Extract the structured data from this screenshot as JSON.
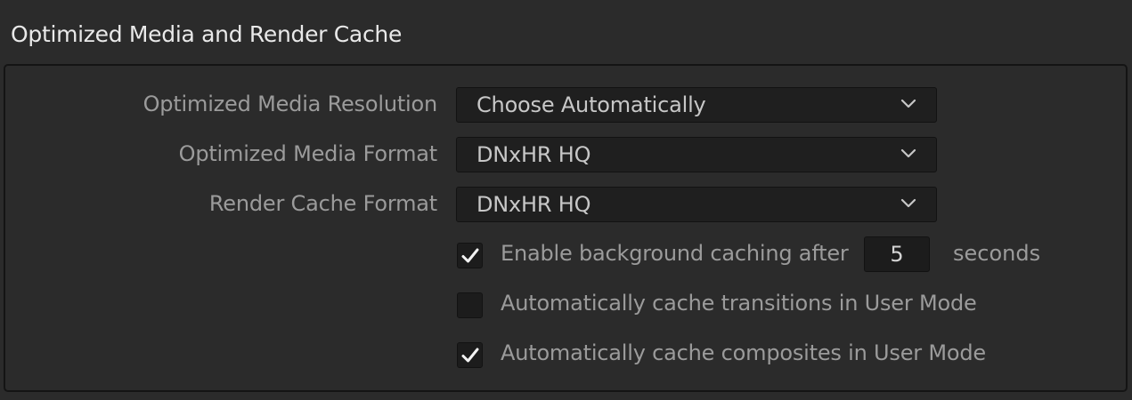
{
  "section": {
    "title": "Optimized Media and Render Cache"
  },
  "rows": {
    "resolution": {
      "label": "Optimized Media Resolution",
      "value": "Choose Automatically"
    },
    "format": {
      "label": "Optimized Media Format",
      "value": "DNxHR HQ"
    },
    "render_cache": {
      "label": "Render Cache Format",
      "value": "DNxHR HQ"
    }
  },
  "checkboxes": {
    "background_caching": {
      "label": "Enable background caching after",
      "checked": true,
      "seconds_value": "5",
      "suffix": "seconds"
    },
    "transitions": {
      "label": "Automatically cache transitions in User Mode",
      "checked": false
    },
    "composites": {
      "label": "Automatically cache composites in User Mode",
      "checked": true
    }
  },
  "icons": {
    "dropdown": "chevron-down-icon",
    "check": "checkmark-icon"
  },
  "colors": {
    "background": "#2b2b2b",
    "field": "#1f1f1f",
    "label": "#9b9b9b",
    "title": "#e9e9e9"
  }
}
